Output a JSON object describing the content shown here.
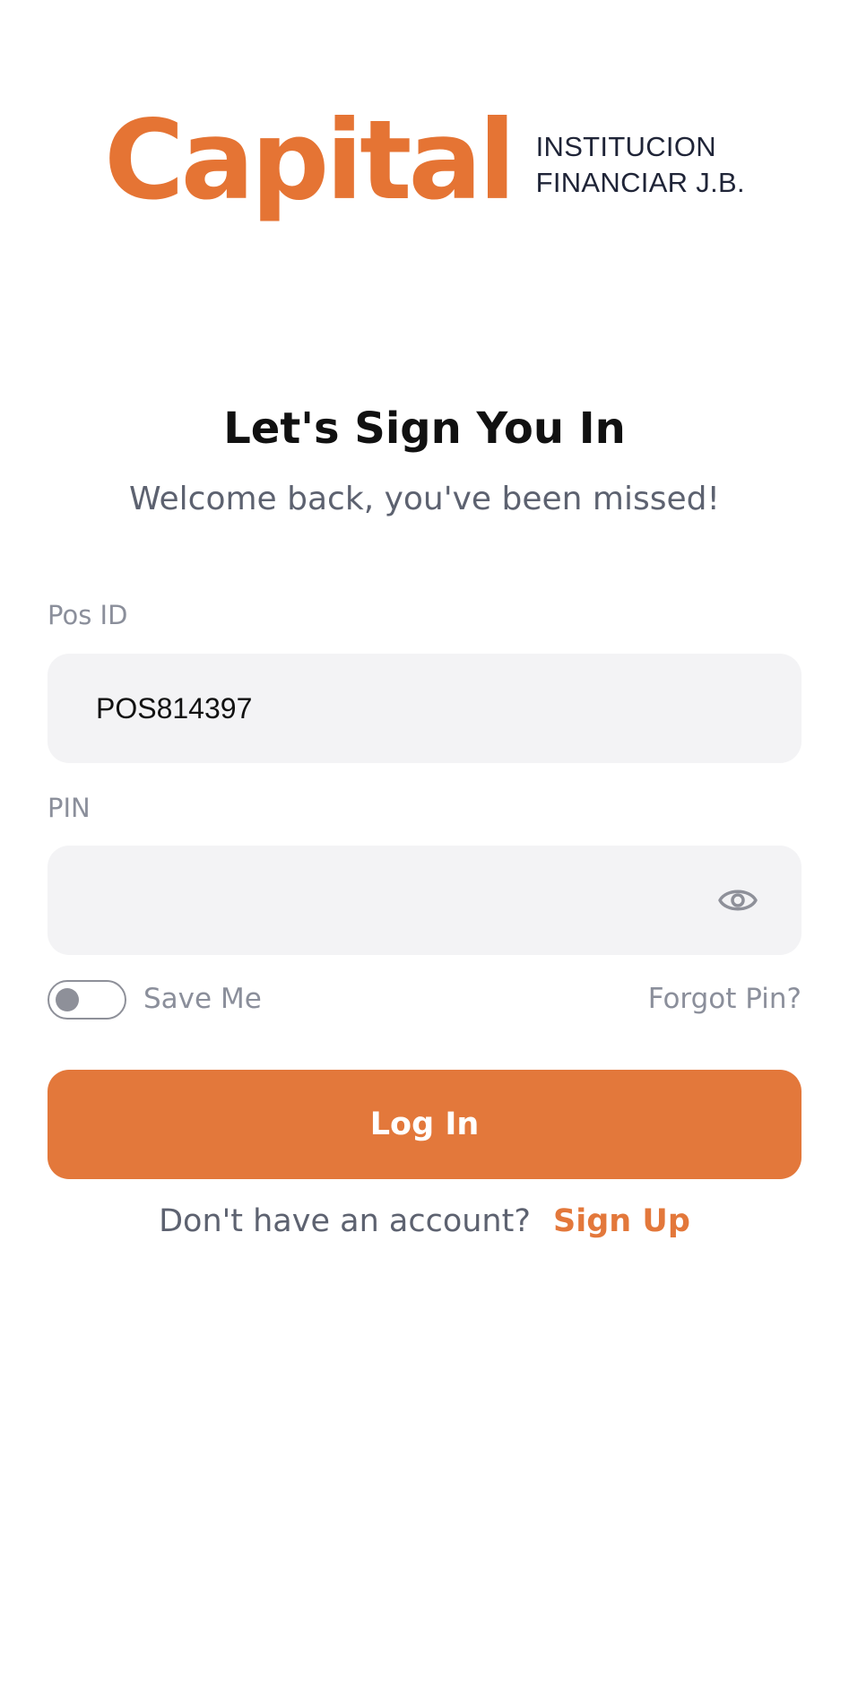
{
  "logo": {
    "word": "Capital",
    "line1": "INSTITUCION",
    "line2": "FINANCIAR J.B."
  },
  "heading": "Let's Sign You In",
  "subheading": "Welcome back, you've been missed!",
  "pos_field": {
    "label": "Pos ID",
    "value": "POS814397"
  },
  "pin_field": {
    "label": "PIN",
    "value": "",
    "visibility_icon": "eye-icon"
  },
  "save_me": {
    "label": "Save Me",
    "enabled": false
  },
  "forgot_label": "Forgot Pin?",
  "login_label": "Log In",
  "signup": {
    "prompt": "Don't have an account?",
    "link": "Sign Up"
  },
  "colors": {
    "accent": "#E3783B",
    "input_bg": "#F3F3F5",
    "muted_text": "#8B8F9B"
  }
}
